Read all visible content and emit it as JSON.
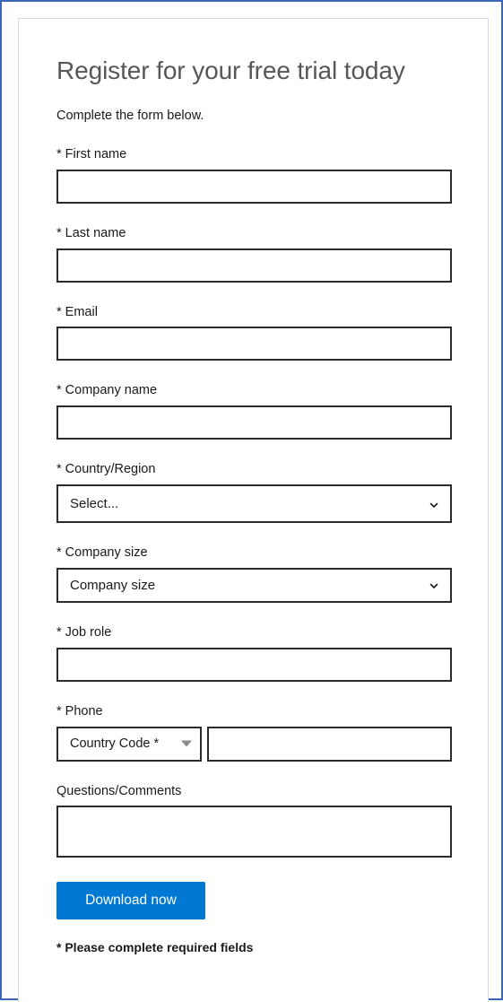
{
  "page": {
    "title": "Register for your free trial today",
    "subtitle": "Complete the form below.",
    "required_note": "* Please complete required fields",
    "accent_color": "#0078D4",
    "frame_color": "#3A66B7",
    "card_border_color": "#D9D9D9",
    "input_border_color": "#2B2B2B",
    "title_color": "#575757"
  },
  "fields": {
    "first_name": {
      "label": "* First name",
      "value": "",
      "placeholder": ""
    },
    "last_name": {
      "label": "* Last name",
      "value": "",
      "placeholder": ""
    },
    "email": {
      "label": "* Email",
      "value": "",
      "placeholder": ""
    },
    "company_name": {
      "label": "* Company name",
      "value": "",
      "placeholder": ""
    },
    "country_region": {
      "label": "* Country/Region",
      "selected": "Select...",
      "icon": "chevron-down-icon"
    },
    "company_size": {
      "label": "* Company size",
      "selected": "Company size",
      "icon": "chevron-down-icon"
    },
    "job_role": {
      "label": "* Job role",
      "value": "",
      "placeholder": ""
    },
    "phone": {
      "label": "* Phone",
      "country_code_selected": "Country Code *",
      "country_code_icon": "triangle-down-icon",
      "number_value": "",
      "number_placeholder": ""
    },
    "questions_comments": {
      "label": "Questions/Comments",
      "value": "",
      "placeholder": ""
    }
  },
  "actions": {
    "submit_label": "Download now"
  }
}
